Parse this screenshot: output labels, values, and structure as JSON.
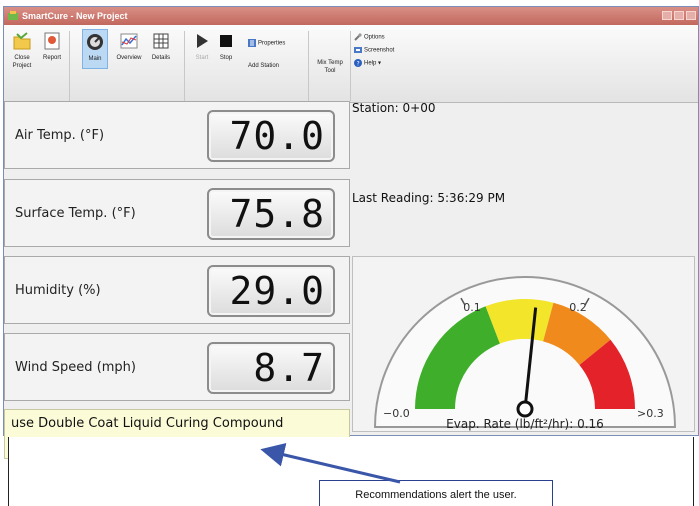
{
  "window": {
    "title": "SmartCure - New Project"
  },
  "ribbon": {
    "buttons": {
      "close_project": "Close Project",
      "report": "Report",
      "main": "Main",
      "overview": "Overview",
      "details": "Details",
      "start": "Start",
      "stop": "Stop",
      "properties": "Properties",
      "add_station": "Add Station",
      "mix_temp_tool": "Mix Temp Tool",
      "options": "Options",
      "screenshot": "Screenshot",
      "help": "Help"
    },
    "active_tab": "Main"
  },
  "readings": [
    {
      "label": "Air Temp. (°F)",
      "value": "70.0"
    },
    {
      "label": "Surface Temp. (°F)",
      "value": "75.8"
    },
    {
      "label": "Humidity (%)",
      "value": "29.0"
    },
    {
      "label": "Wind Speed (mph)",
      "value": "8.7"
    }
  ],
  "station": "Station: 0+00",
  "last_reading": "Last Reading: 5:36:29 PM",
  "recommendation": "use Double Coat Liquid Curing Compound",
  "gauge": {
    "caption": "Evap. Rate (lb/ft²/hr): 0.16",
    "value": 0.16,
    "min": 0.0,
    "max": 0.3,
    "ticks": [
      "0.1",
      "0.2"
    ],
    "min_label": "−0.0",
    "max_label": ">0.3",
    "zone_colors": [
      "#3fae2a",
      "#f2e52a",
      "#f08a1c",
      "#e3222a"
    ]
  },
  "annotation": {
    "callout": "Recommendations alert the user.",
    "arrow_color": "#3a56a8"
  }
}
